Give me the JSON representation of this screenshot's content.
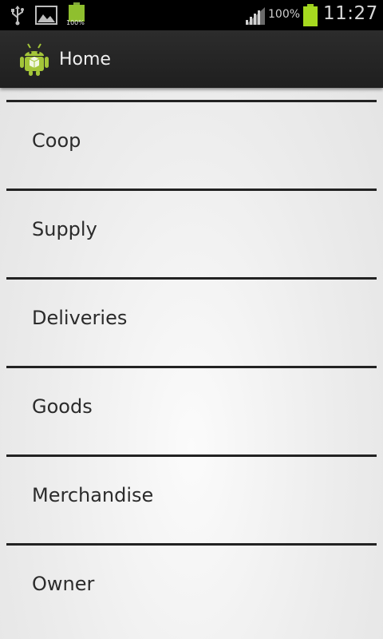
{
  "status_bar": {
    "notification_battery_label": "100%",
    "battery_percent": "100%",
    "time": "11:27",
    "icons": [
      "usb-icon",
      "image-icon",
      "battery-full-icon",
      "signal-icon",
      "battery-icon"
    ]
  },
  "action_bar": {
    "title": "Home",
    "icon": "android-app-icon"
  },
  "menu": {
    "items": [
      {
        "label": "Coop"
      },
      {
        "label": "Supply"
      },
      {
        "label": "Deliveries"
      },
      {
        "label": "Goods"
      },
      {
        "label": "Merchandise"
      },
      {
        "label": "Owner"
      }
    ]
  },
  "colors": {
    "status_bar_bg": "#000000",
    "action_bar_bg": "#262626",
    "list_bg": "#ececec",
    "divider": "#222222",
    "item_text": "#2b2b2b",
    "accent_green": "#a4c639"
  }
}
